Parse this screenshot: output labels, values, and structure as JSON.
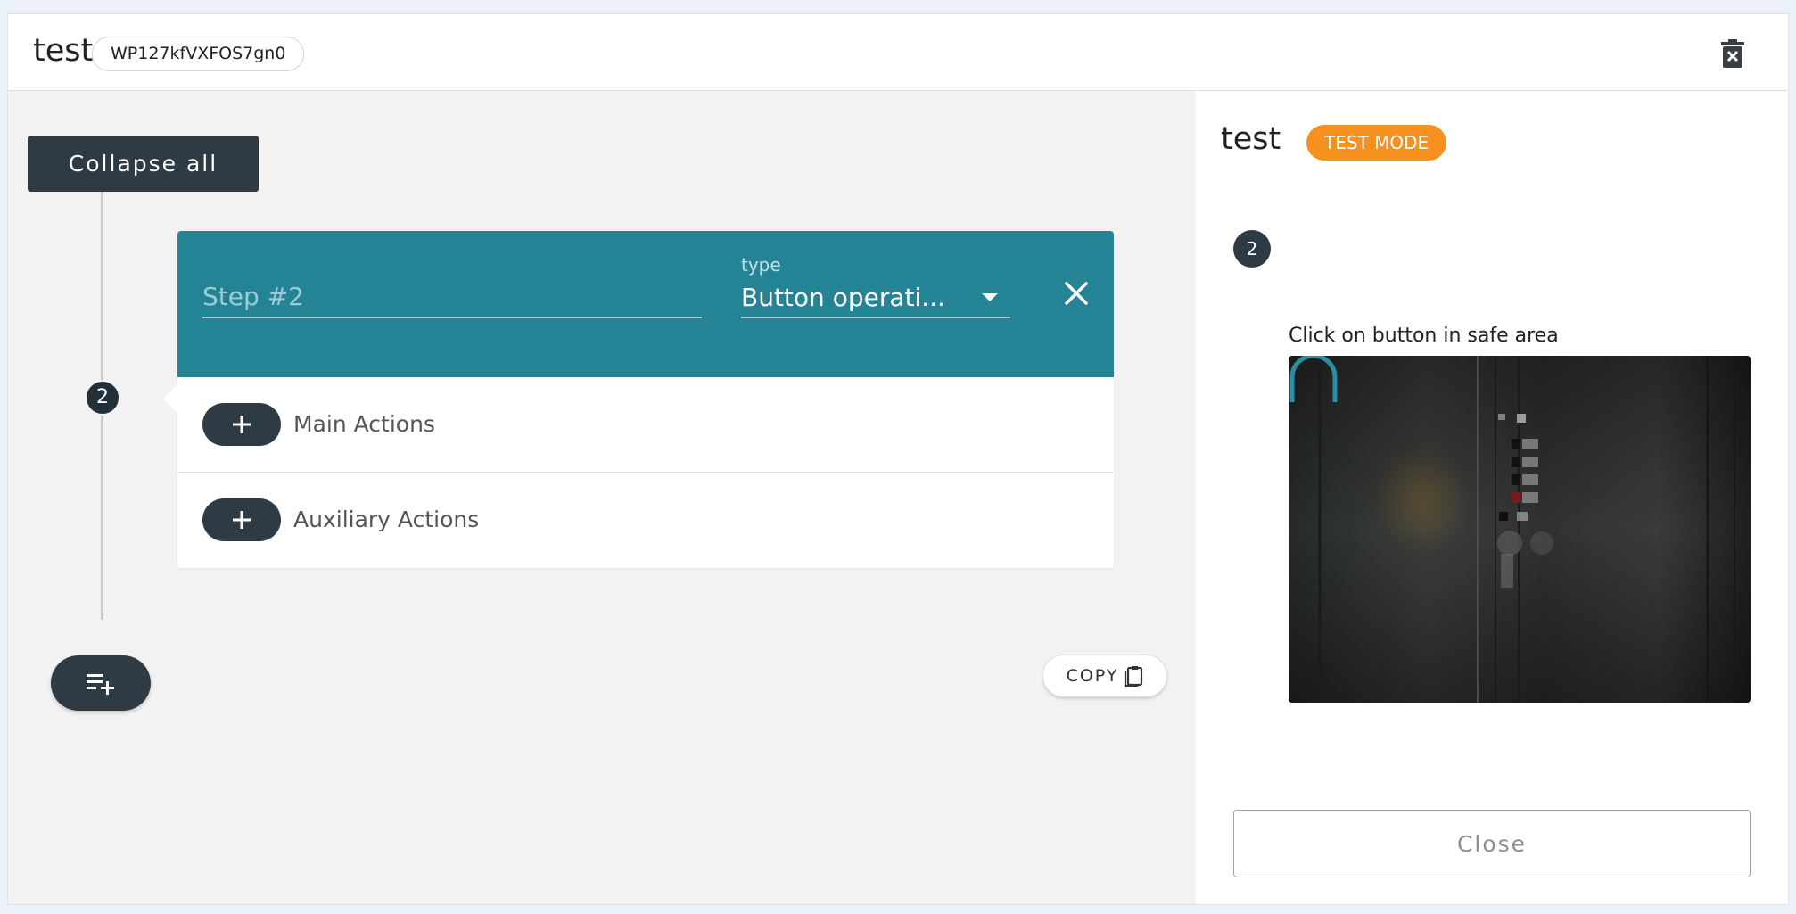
{
  "header": {
    "title": "test",
    "id_chip": "WP127kfVXFOS7gn0",
    "delete_icon": "trash-icon"
  },
  "editor": {
    "collapse_label": "Collapse all",
    "step_number": "2",
    "step": {
      "name_placeholder": "Step #2",
      "type_label": "type",
      "type_value": "Button operati...",
      "main_actions_label": "Main Actions",
      "auxiliary_actions_label": "Auxiliary Actions"
    },
    "copy_label": "COPY",
    "add_step_icon": "playlist-add-icon"
  },
  "preview": {
    "title": "test",
    "mode_badge": "TEST MODE",
    "step_number": "2",
    "instruction": "Click on button in safe area",
    "close_label": "Close"
  },
  "colors": {
    "accent_teal": "#258396",
    "dark": "#2e3a44",
    "badge_orange": "#f6901e"
  }
}
